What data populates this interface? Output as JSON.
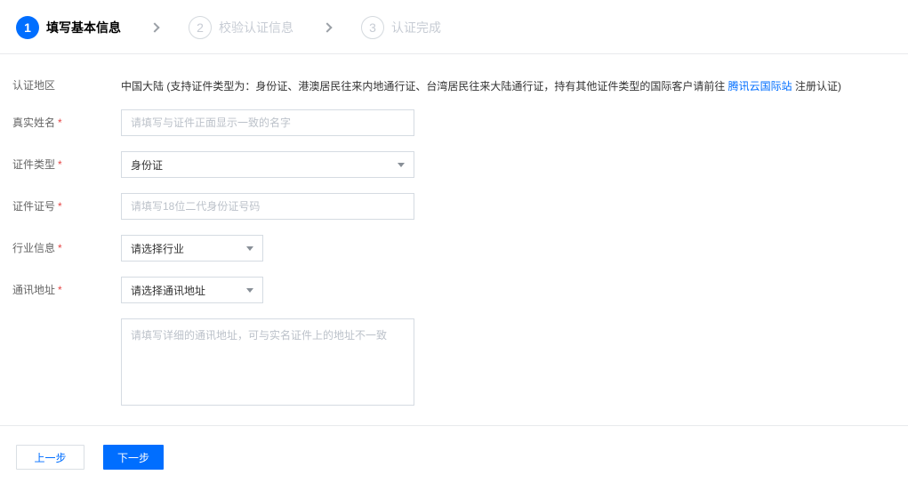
{
  "steps": {
    "items": [
      {
        "number": "1",
        "label": "填写基本信息",
        "state": "active"
      },
      {
        "number": "2",
        "label": "校验认证信息",
        "state": "inactive"
      },
      {
        "number": "3",
        "label": "认证完成",
        "state": "inactive"
      }
    ]
  },
  "form": {
    "region": {
      "label": "认证地区",
      "value_prefix": "中国大陆 (支持证件类型为：身份证、港澳居民往来内地通行证、台湾居民往来大陆通行证，持有其他证件类型的国际客户请前往 ",
      "link_text": "腾讯云国际站",
      "value_suffix": " 注册认证)"
    },
    "real_name": {
      "label": "真实姓名",
      "required": "*",
      "placeholder": "请填写与证件正面显示一致的名字",
      "value": ""
    },
    "id_type": {
      "label": "证件类型",
      "required": "*",
      "value": "身份证"
    },
    "id_number": {
      "label": "证件证号",
      "required": "*",
      "placeholder": "请填写18位二代身份证号码",
      "value": ""
    },
    "industry": {
      "label": "行业信息",
      "required": "*",
      "value": "请选择行业"
    },
    "address": {
      "label": "通讯地址",
      "required": "*",
      "value": "请选择通讯地址"
    },
    "address_detail": {
      "placeholder": "请填写详细的通讯地址，可与实名证件上的地址不一致",
      "value": ""
    }
  },
  "actions": {
    "prev_label": "上一步",
    "next_label": "下一步"
  },
  "colors": {
    "accent": "#006eff",
    "link": "#006eff",
    "required": "#e54545",
    "inactive_step": "#c7ccd4",
    "border": "#d5dbe2"
  }
}
